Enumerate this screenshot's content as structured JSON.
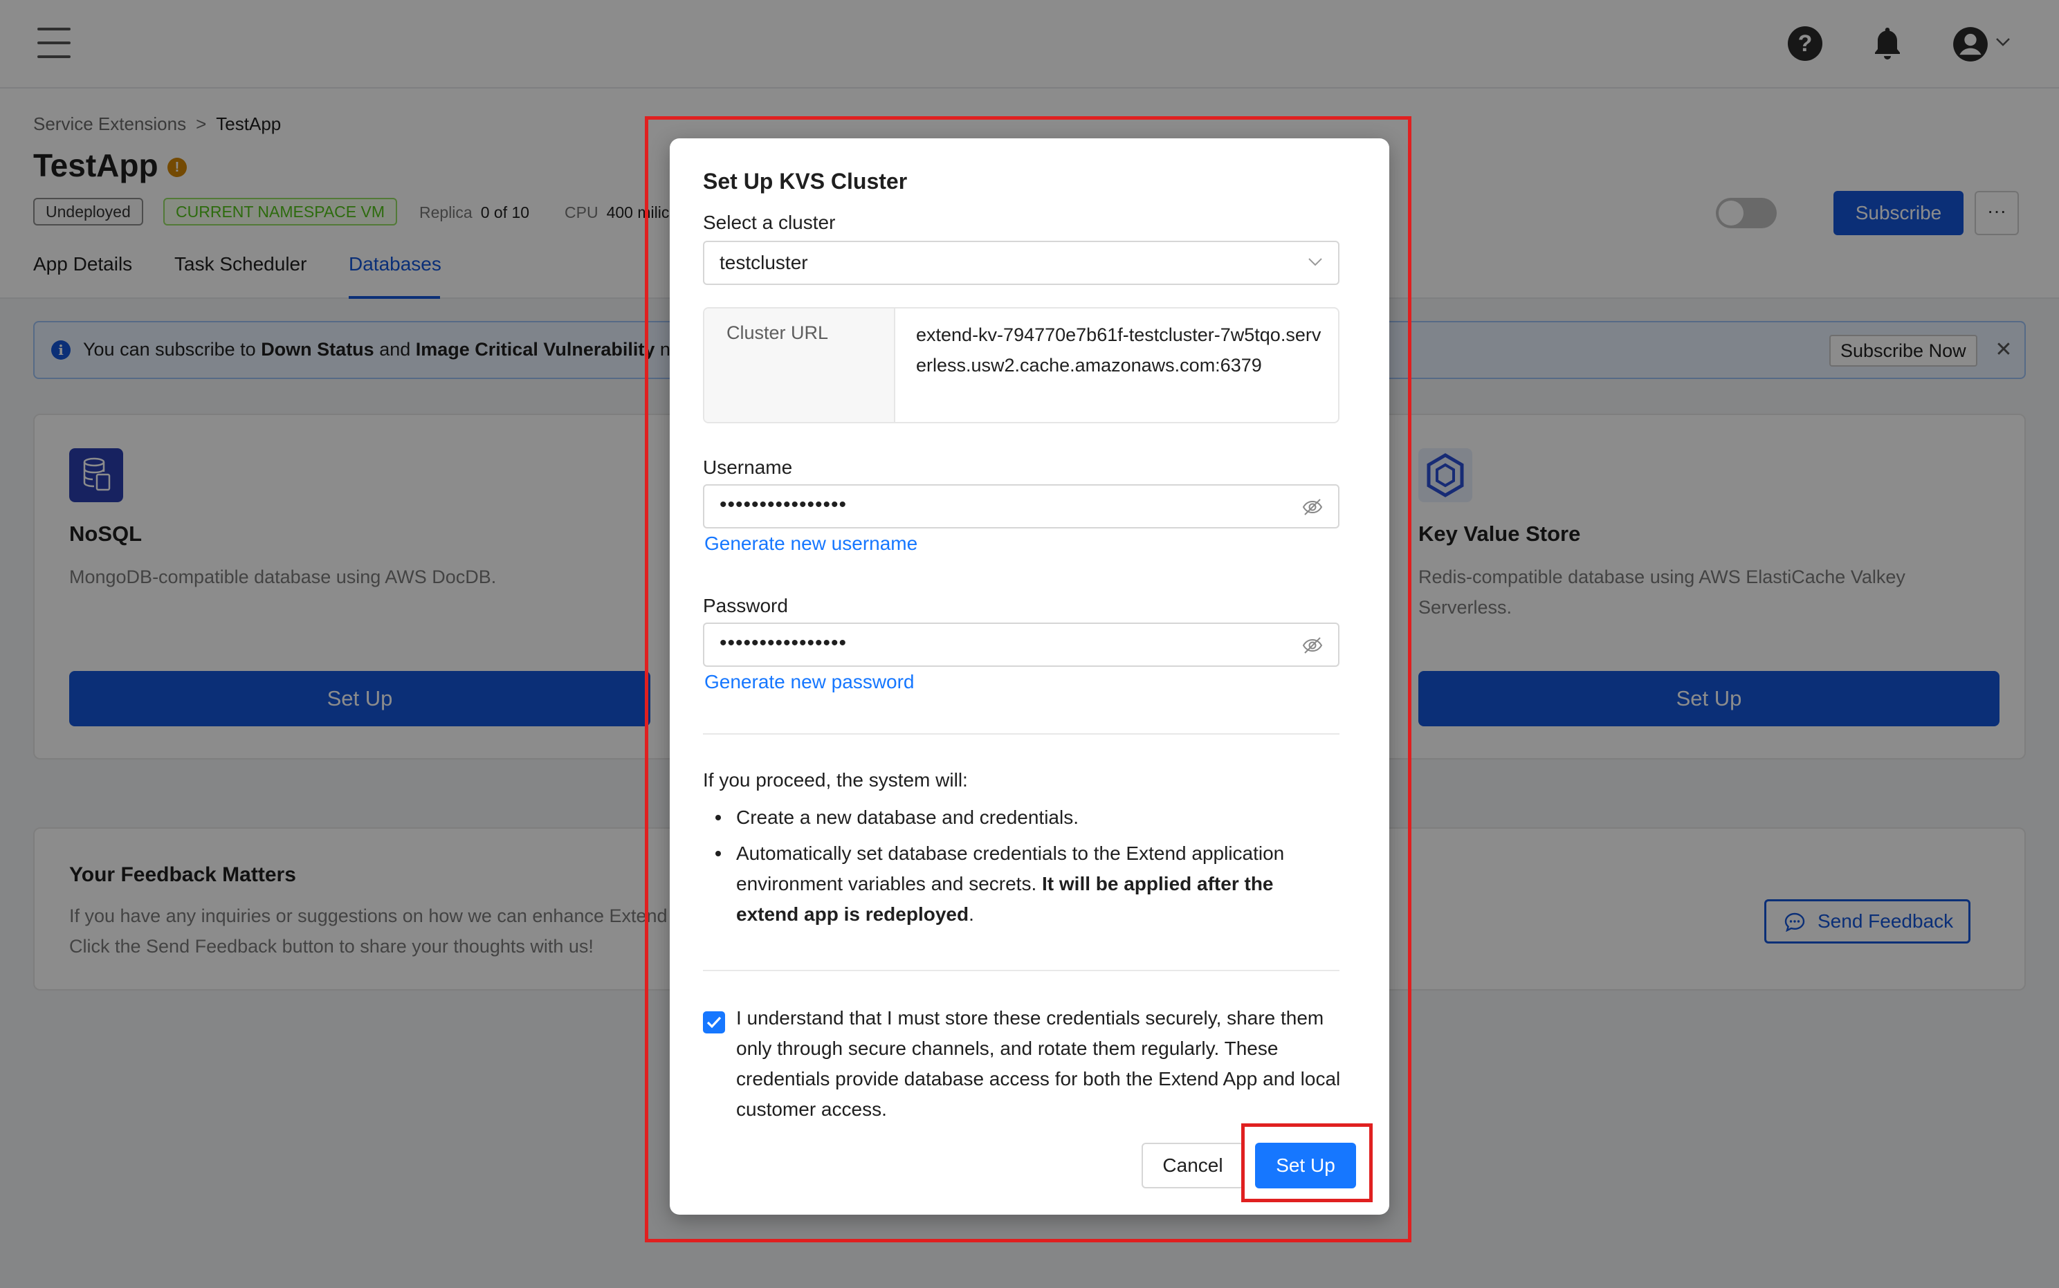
{
  "topbar": {
    "help_glyph": "?"
  },
  "breadcrumb": {
    "parent": "Service Extensions",
    "separator": ">",
    "current": "TestApp"
  },
  "app": {
    "title": "TestApp",
    "info_glyph": "!",
    "status_badge": "Undeployed",
    "namespace_badge": "CURRENT NAMESPACE VM",
    "replica_label": "Replica",
    "replica_value": "0 of 10",
    "cpu_label": "CPU",
    "cpu_value": "400 milic",
    "subscribe_label": "Subscribe",
    "more_label": "···"
  },
  "tabs": [
    {
      "label": "App Details"
    },
    {
      "label": "Task Scheduler"
    },
    {
      "label": "Databases",
      "active": true
    }
  ],
  "alert": {
    "info_glyph": "i",
    "text_prefix": "You can subscribe to ",
    "bold_1": "Down Status",
    "text_mid": " and ",
    "bold_2": "Image Critical Vulnerability",
    "text_suffix": " no",
    "action_label": "Subscribe Now",
    "close_glyph": "✕"
  },
  "cards": {
    "nosql": {
      "title": "NoSQL",
      "description": "MongoDB-compatible database using AWS DocDB.",
      "button_label": "Set Up"
    },
    "kvs": {
      "title": "Key Value Store",
      "description": "Redis-compatible database using AWS ElastiCache Valkey Serverless.",
      "button_label": "Set Up"
    }
  },
  "feedback": {
    "title": "Your Feedback Matters",
    "line1": "If you have any inquiries or suggestions on how we can enhance Extend",
    "line2": "Click the Send Feedback button to share your thoughts with us!",
    "button_label": "Send Feedback"
  },
  "modal": {
    "title": "Set Up KVS Cluster",
    "cluster_label": "Select a cluster",
    "cluster_value": "testcluster",
    "cluster_url_label": "Cluster URL",
    "cluster_url_value": "extend-kv-794770e7b61f-testcluster-7w5tqo.serverless.usw2.cache.amazonaws.com:6379",
    "username_label": "Username",
    "username_value": "••••••••••••••••",
    "generate_username_label": "Generate new username",
    "password_label": "Password",
    "password_value": "••••••••••••••••",
    "generate_password_label": "Generate new password",
    "proceed_text": "If you proceed, the system will:",
    "bullet_1": "Create a new database and credentials.",
    "bullet_2_text": "Automatically set database credentials to the Extend application environment variables and secrets. ",
    "bullet_2_bold": "It will be applied after the extend app is redeployed",
    "bullet_2_end": ".",
    "acknowledge_text": "I understand that I must store these credentials securely, share them only through secure channels, and rotate them regularly. These credentials provide database access for both the Extend App and local customer access.",
    "acknowledge_checked": true,
    "cancel_label": "Cancel",
    "setup_label": "Set Up"
  },
  "colors": {
    "primary": "#1456d9",
    "modal_primary": "#1677ff",
    "highlight": "#e02020",
    "success": "#52c41a",
    "warning": "#d48806"
  }
}
